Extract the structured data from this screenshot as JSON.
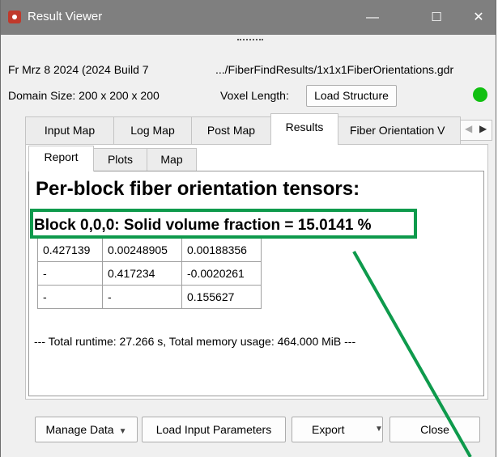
{
  "window": {
    "title": "Result Viewer",
    "controls": {
      "minimize": "—",
      "maximize": "☐",
      "close": "✕"
    }
  },
  "header": {
    "version": "Fr Mrz 8 2024 (2024 Build 7",
    "path": ".../FiberFindResults/1x1x1FiberOrientations.gdr",
    "domain_size": "Domain Size: 200 x 200 x 200",
    "voxel_length": "Voxel Length:",
    "load_structure": "Load Structure",
    "status_color": "#11c011"
  },
  "tabs": [
    {
      "label": "Input Map",
      "active": false
    },
    {
      "label": "Log Map",
      "active": false
    },
    {
      "label": "Post Map",
      "active": false
    },
    {
      "label": "Results",
      "active": true
    },
    {
      "label": "Fiber Orientation V",
      "active": false
    }
  ],
  "subtabs": [
    {
      "label": "Report",
      "active": true
    },
    {
      "label": "Plots",
      "active": false
    },
    {
      "label": "Map",
      "active": false
    }
  ],
  "report": {
    "heading": "Per-block fiber orientation tensors:",
    "block_line": "Block 0,0,0: Solid volume fraction = 15.0141 %",
    "tensor": [
      [
        "0.427139",
        "0.00248905",
        "0.00188356"
      ],
      [
        "-",
        "0.417234",
        "-0.0020261"
      ],
      [
        "-",
        "-",
        "0.155627"
      ]
    ],
    "runtime": "--- Total runtime: 27.266 s, Total memory usage: 464.000 MiB ---"
  },
  "footer": {
    "manage_data": "Manage Data",
    "load_input": "Load Input Parameters",
    "export": "Export",
    "close": "Close"
  },
  "annotation": {
    "color": "#0e9a4c"
  }
}
